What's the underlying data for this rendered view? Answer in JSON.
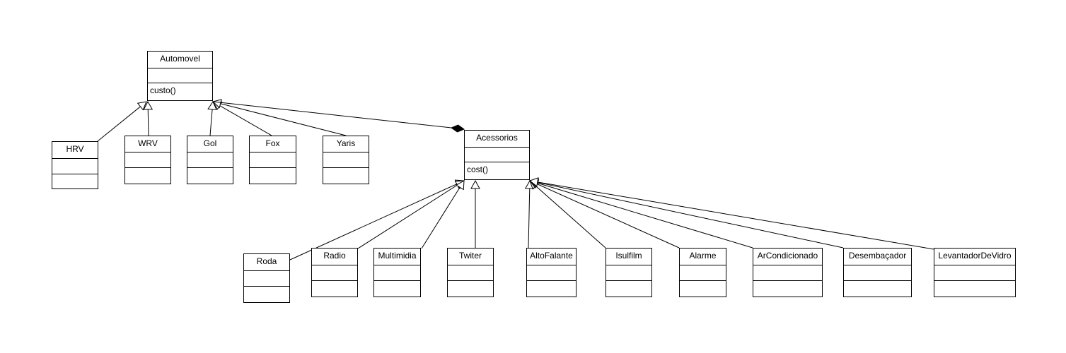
{
  "diagram": {
    "classes": {
      "automovel": {
        "name": "Automovel",
        "operations": [
          "custo()"
        ]
      },
      "acessorios": {
        "name": "Acessorios",
        "operations": [
          "cost()"
        ]
      },
      "hrv": {
        "name": "HRV"
      },
      "wrv": {
        "name": "WRV"
      },
      "gol": {
        "name": "Gol"
      },
      "fox": {
        "name": "Fox"
      },
      "yaris": {
        "name": "Yaris"
      },
      "roda": {
        "name": "Roda"
      },
      "radio": {
        "name": "Radio"
      },
      "multimidia": {
        "name": "Multimidia"
      },
      "twiter": {
        "name": "Twiter"
      },
      "altofalante": {
        "name": "AltoFalante"
      },
      "isulfilm": {
        "name": "Isulfilm"
      },
      "alarme": {
        "name": "Alarme"
      },
      "arcondicionado": {
        "name": "ArCondicionado"
      },
      "desembacador": {
        "name": "Desembaçador"
      },
      "levantadordevidro": {
        "name": "LevantadorDeVidro"
      }
    },
    "relationships": [
      {
        "type": "generalization",
        "from": "hrv",
        "to": "automovel"
      },
      {
        "type": "generalization",
        "from": "wrv",
        "to": "automovel"
      },
      {
        "type": "generalization",
        "from": "gol",
        "to": "automovel"
      },
      {
        "type": "generalization",
        "from": "fox",
        "to": "automovel"
      },
      {
        "type": "generalization",
        "from": "yaris",
        "to": "automovel"
      },
      {
        "type": "composition",
        "from": "automovel",
        "to": "acessorios"
      },
      {
        "type": "generalization",
        "from": "roda",
        "to": "acessorios"
      },
      {
        "type": "generalization",
        "from": "radio",
        "to": "acessorios"
      },
      {
        "type": "generalization",
        "from": "multimidia",
        "to": "acessorios"
      },
      {
        "type": "generalization",
        "from": "twiter",
        "to": "acessorios"
      },
      {
        "type": "generalization",
        "from": "altofalante",
        "to": "acessorios"
      },
      {
        "type": "generalization",
        "from": "isulfilm",
        "to": "acessorios"
      },
      {
        "type": "generalization",
        "from": "alarme",
        "to": "acessorios"
      },
      {
        "type": "generalization",
        "from": "arcondicionado",
        "to": "acessorios"
      },
      {
        "type": "generalization",
        "from": "desembacador",
        "to": "acessorios"
      },
      {
        "type": "generalization",
        "from": "levantadordevidro",
        "to": "acessorios"
      }
    ]
  }
}
